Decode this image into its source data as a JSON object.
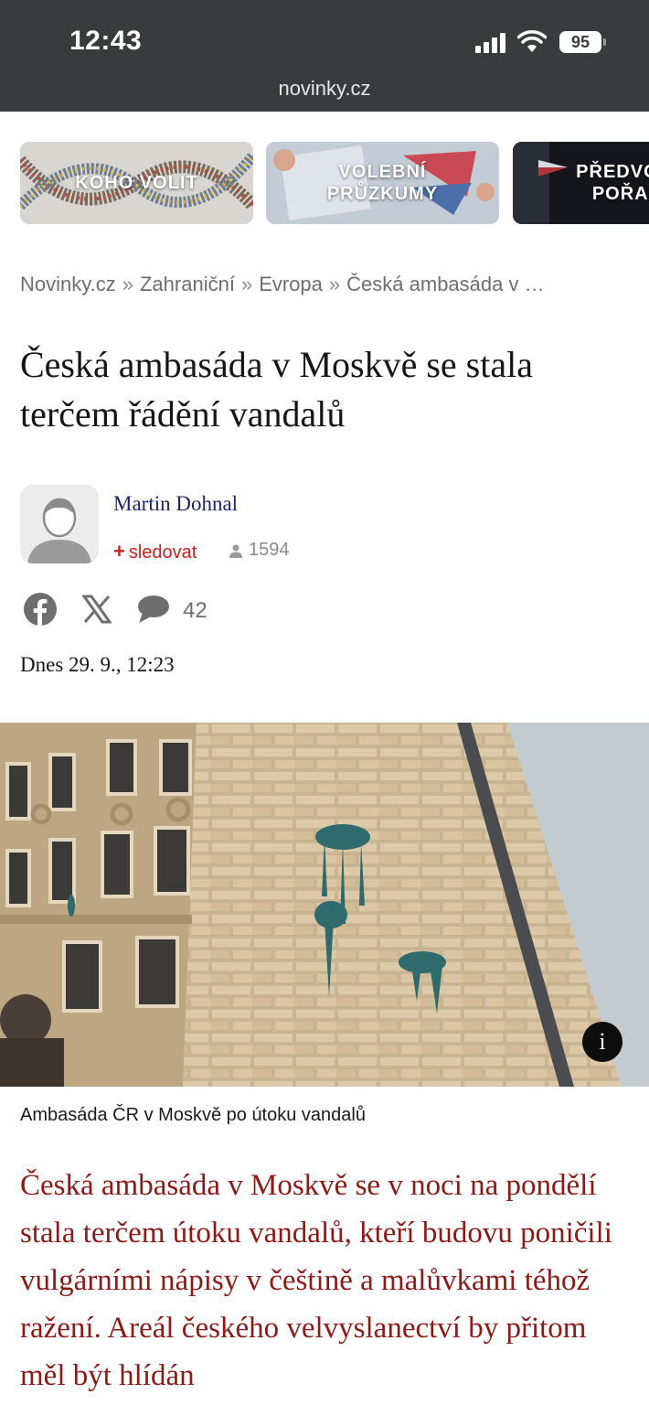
{
  "status_bar": {
    "time": "12:43",
    "battery": "95"
  },
  "browser": {
    "url": "novinky.cz"
  },
  "topics": [
    {
      "label": "KOHO VOLIT"
    },
    {
      "label": "VOLEBNÍ PRŮZKUMY"
    },
    {
      "label": "PŘEDVOL POŘAI"
    }
  ],
  "breadcrumb": {
    "items": [
      "Novinky.cz",
      "Zahraniční",
      "Evropa",
      "Česká ambasáda v …"
    ],
    "separator": "»"
  },
  "article": {
    "title": "Česká ambasáda v Moskvě se stala terčem řádění vandalů",
    "author": {
      "name": "Martin Dohnal",
      "follow_label": "sledovat",
      "followers": "1594"
    },
    "comments_count": "42",
    "date": "Dnes 29. 9., 12:23",
    "image_caption": "Ambasáda ČR v Moskvě po útoku vandalů",
    "info_label": "i",
    "lead": "Česká ambasáda v Moskvě se v noci na pondělí stala terčem útoku vandalů, kteří budovu poničili vulgárními nápisy v češtině a malůvkami téhož ražení. Areál českého velvyslanectví by přitom měl být hlídán"
  },
  "colors": {
    "status_bar_bg": "#3a3b3d",
    "author_link": "#1f2368",
    "follow_accent": "#c8211f",
    "lead_text": "#8b1a16"
  },
  "icons": [
    "signal-icon",
    "wifi-icon",
    "battery-icon",
    "avatar-placeholder-icon",
    "user-icon",
    "facebook-icon",
    "x-icon",
    "comment-icon",
    "info-icon"
  ]
}
